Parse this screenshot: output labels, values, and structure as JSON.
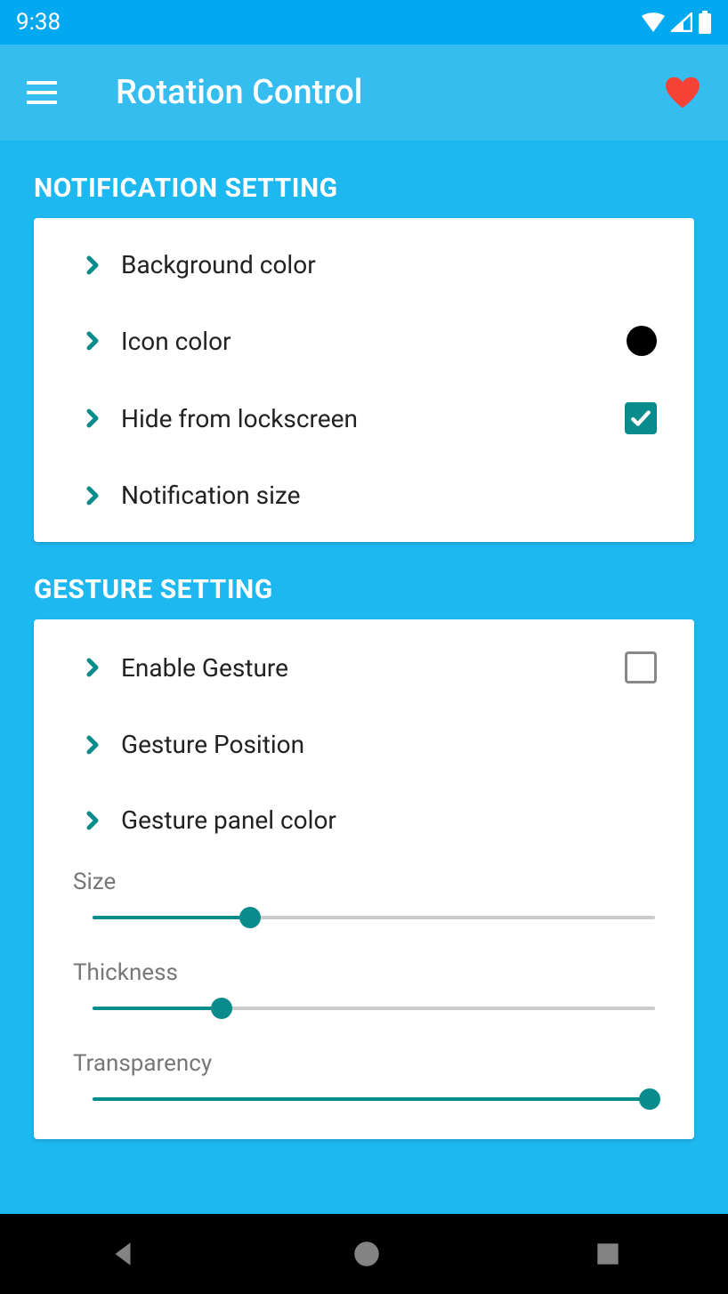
{
  "status": {
    "time": "9:38"
  },
  "app": {
    "title": "Rotation Control"
  },
  "sections": {
    "notification": {
      "header": "NOTIFICATION SETTING",
      "items": {
        "bg": "Background color",
        "icon": "Icon color",
        "hide": "Hide from lockscreen",
        "size": "Notification size"
      },
      "icon_color": "#000000",
      "hide_checked": true
    },
    "gesture": {
      "header": "GESTURE SETTING",
      "items": {
        "enable": "Enable Gesture",
        "position": "Gesture Position",
        "panel_color": "Gesture panel color"
      },
      "enable_checked": false,
      "sliders": {
        "size": {
          "label": "Size",
          "value": 28
        },
        "thickness": {
          "label": "Thickness",
          "value": 23
        },
        "transparency": {
          "label": "Transparency",
          "value": 99
        }
      }
    }
  },
  "colors": {
    "accent": "#0a8c8c",
    "bg": "#1eb8f0",
    "heart": "#f44336"
  }
}
